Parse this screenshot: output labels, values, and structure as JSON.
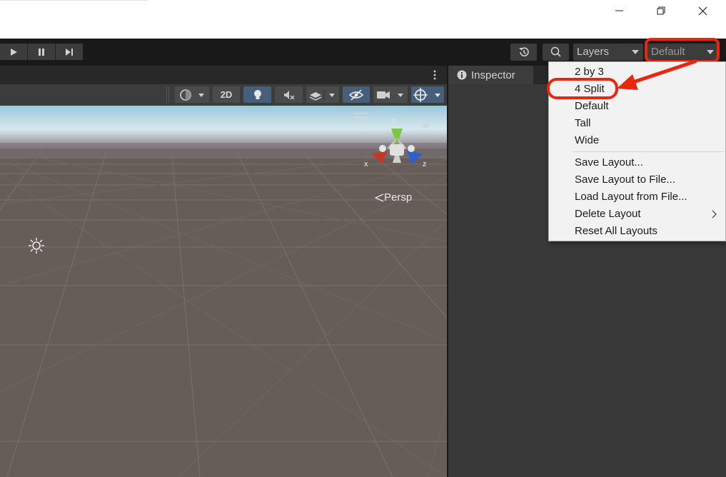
{
  "toolbar": {
    "layers_label": "Layers",
    "layout_label": "Default"
  },
  "scene": {
    "gizmo": {
      "y": "y",
      "x": "x",
      "z": "z"
    },
    "persp_label": "Persp",
    "btn_2d": "2D"
  },
  "inspector": {
    "tab_label": "Inspector"
  },
  "layout_menu": {
    "items": [
      "2 by 3",
      "4 Split",
      "Default",
      "Tall",
      "Wide"
    ],
    "actions": [
      "Save Layout...",
      "Save Layout to File...",
      "Load Layout from File...",
      "Delete Layout",
      "Reset All Layouts"
    ]
  },
  "colors": {
    "accent_callout": "#e8280e",
    "toolbar_bg": "#191919",
    "panel_bg": "#383838",
    "active_button": "#46607c"
  }
}
